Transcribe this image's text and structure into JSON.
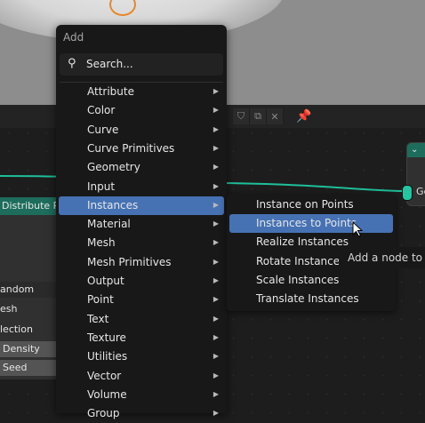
{
  "editor_header": {
    "icons": [
      "shield-icon",
      "copy-icon",
      "close-icon"
    ],
    "pin_icon": "pin-icon"
  },
  "left_node": {
    "header": "Distribute Po",
    "rows": [
      "andom",
      "esh",
      "lection",
      "Density",
      "Seed"
    ]
  },
  "right_node": {
    "header_icon": "chevron-down-icon",
    "socket_label": "Ge"
  },
  "add_menu": {
    "title": "Add",
    "search_label": "Search...",
    "items": [
      {
        "label": "Attribute",
        "underline": "A",
        "has_submenu": true
      },
      {
        "label": "Color",
        "underline": "C",
        "has_submenu": true
      },
      {
        "label": "Curve",
        "underline": "u",
        "has_submenu": true
      },
      {
        "label": "Curve Primitives",
        "underline": "P",
        "has_submenu": true
      },
      {
        "label": "Geometry",
        "underline": "G",
        "has_submenu": true
      },
      {
        "label": "Input",
        "underline": "I",
        "has_submenu": true
      },
      {
        "label": "Instances",
        "underline": "n",
        "has_submenu": true,
        "active": true
      },
      {
        "label": "Material",
        "underline": "M",
        "has_submenu": true
      },
      {
        "label": "Mesh",
        "underline": "e",
        "has_submenu": true
      },
      {
        "label": "Mesh Primitives",
        "underline": "h",
        "has_submenu": true
      },
      {
        "label": "Output",
        "underline": "O",
        "has_submenu": true
      },
      {
        "label": "Point",
        "underline": "o",
        "has_submenu": true
      },
      {
        "label": "Text",
        "underline": "T",
        "has_submenu": true
      },
      {
        "label": "Texture",
        "underline": "x",
        "has_submenu": true
      },
      {
        "label": "Utilities",
        "underline": "U",
        "has_submenu": true
      },
      {
        "label": "Vector",
        "underline": "V",
        "has_submenu": true
      },
      {
        "label": "Volume",
        "underline": "l",
        "has_submenu": true
      },
      {
        "label": "Group",
        "underline": "r",
        "has_submenu": true
      }
    ]
  },
  "instances_submenu": {
    "items": [
      {
        "label": "Instance on Points"
      },
      {
        "label": "Instances to Points",
        "active": true
      },
      {
        "label": "Realize Instances"
      },
      {
        "label": "Rotate Instances"
      },
      {
        "label": "Scale Instances"
      },
      {
        "label": "Translate Instances"
      }
    ]
  },
  "tooltip": "Add a node to the",
  "colors": {
    "accent": "#4672b4",
    "node_header": "#1e6d5c",
    "socket": "#26c4a0",
    "menu_bg": "#181818"
  }
}
